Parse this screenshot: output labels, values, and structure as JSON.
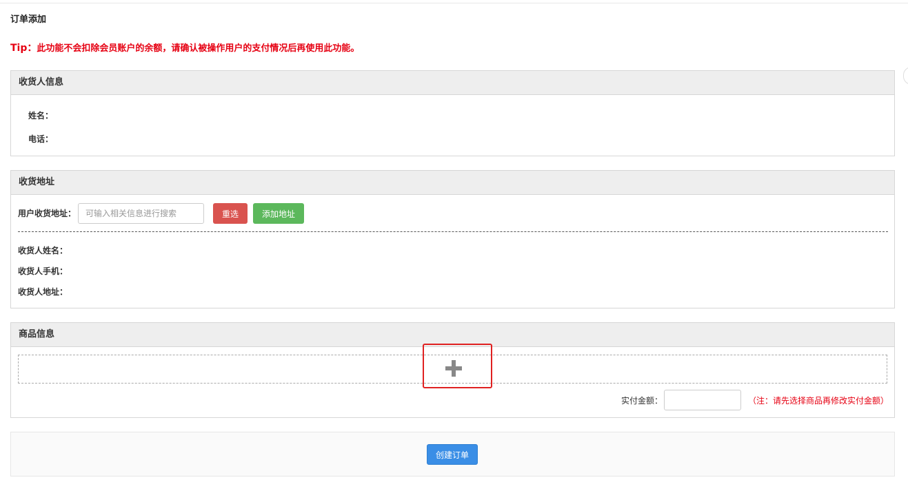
{
  "page": {
    "title": "订单添加",
    "tip_prefix": "Tip：",
    "tip_text": "此功能不会扣除会员账户的余额，请确认被操作用户的支付情况后再使用此功能。"
  },
  "receiver_info": {
    "heading": "收货人信息",
    "name_label": "姓名：",
    "phone_label": "电话："
  },
  "shipping_address": {
    "heading": "收货地址",
    "search_label": "用户收货地址：",
    "search_placeholder": "可输入相关信息进行搜索",
    "search_value": "",
    "reset_button": "重选",
    "add_button": "添加地址",
    "receiver_name_label": "收货人姓名：",
    "receiver_mobile_label": "收货人手机：",
    "receiver_address_label": "收货人地址："
  },
  "goods_info": {
    "heading": "商品信息",
    "add_icon": "plus-icon",
    "paid_amount_label": "实付金额：",
    "paid_amount_value": "",
    "paid_amount_note": "（注：请先选择商品再修改实付金额）"
  },
  "footer": {
    "create_button": "创建订单"
  },
  "colors": {
    "tip": "#e60012",
    "reset_button": "#d9534f",
    "add_button": "#5cb85c",
    "create_button": "#3a8ee6",
    "highlight_box": "#e02020"
  }
}
